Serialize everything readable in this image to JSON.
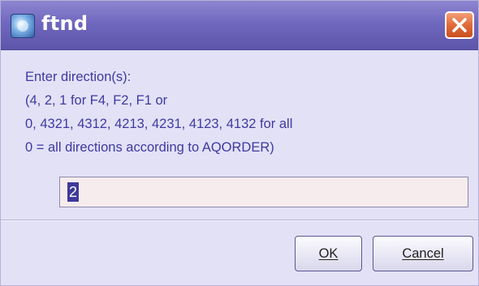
{
  "window": {
    "title": "ftnd"
  },
  "message": {
    "lines": [
      "Enter direction(s):",
      "(4, 2, 1 for F4, F2, F1 or",
      "0, 4321, 4312, 4213, 4231, 4123, 4132 for all",
      "0 = all directions according to AQORDER)"
    ]
  },
  "input": {
    "value": "2"
  },
  "buttons": {
    "ok_label": "OK",
    "cancel_label": "Cancel"
  },
  "colors": {
    "title_bar": "#7068be",
    "message_text": "#3e3aa0",
    "close_button": "#e06a3a",
    "input_background": "#f6ecee",
    "selection": "#3e3a9c"
  }
}
